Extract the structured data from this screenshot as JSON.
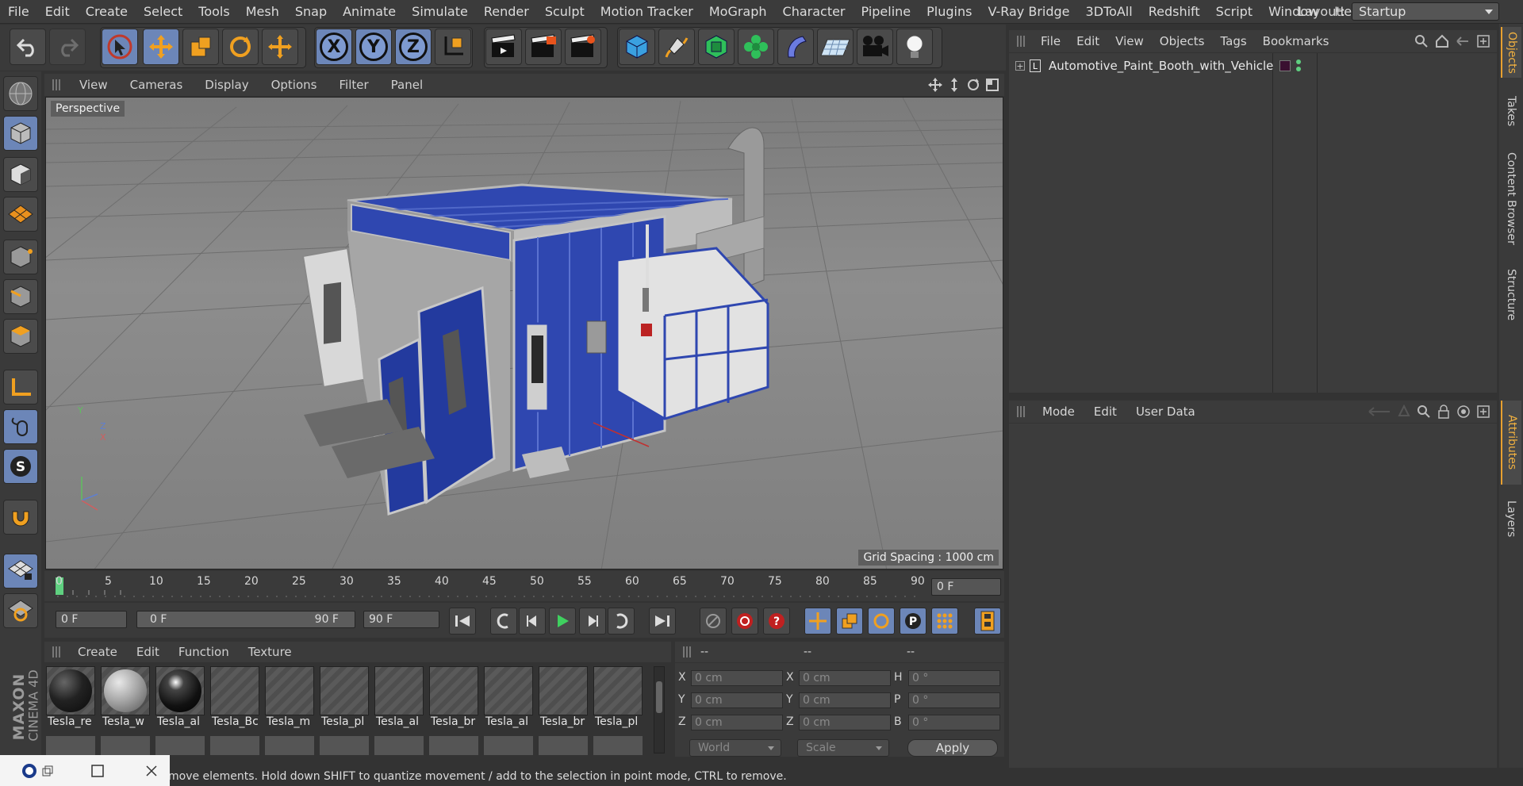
{
  "menubar": {
    "items": [
      "File",
      "Edit",
      "Create",
      "Select",
      "Tools",
      "Mesh",
      "Snap",
      "Animate",
      "Simulate",
      "Render",
      "Sculpt",
      "Motion Tracker",
      "MoGraph",
      "Character",
      "Pipeline",
      "Plugins",
      "V-Ray Bridge",
      "3DToAll",
      "Redshift",
      "Script",
      "Window",
      "Help"
    ],
    "layout_label": "Layout:",
    "layout_value": "Startup"
  },
  "toolbar": {
    "axis_x": "X",
    "axis_y": "Y",
    "axis_z": "Z"
  },
  "viewport": {
    "menu": [
      "View",
      "Cameras",
      "Display",
      "Options",
      "Filter",
      "Panel"
    ],
    "label": "Perspective",
    "grid_spacing": "Grid Spacing : 1000 cm",
    "axis_y": "Y",
    "axis_z": "Z",
    "axis_x": "X"
  },
  "timeline": {
    "ticks": [
      "0",
      "5",
      "10",
      "15",
      "20",
      "25",
      "30",
      "35",
      "40",
      "45",
      "50",
      "55",
      "60",
      "65",
      "70",
      "75",
      "80",
      "85",
      "90"
    ],
    "current_frame": "0 F"
  },
  "transport": {
    "start": "0 F",
    "range_start": "0 F",
    "range_end": "90 F",
    "end": "90 F"
  },
  "materials": {
    "menu": [
      "Create",
      "Edit",
      "Function",
      "Texture"
    ],
    "items": [
      "Tesla_re",
      "Tesla_w",
      "Tesla_al",
      "Tesla_Bc",
      "Tesla_m",
      "Tesla_pl",
      "Tesla_al",
      "Tesla_br",
      "Tesla_al",
      "Tesla_br",
      "Tesla_pl"
    ]
  },
  "coords": {
    "head": [
      "--",
      "--",
      "--"
    ],
    "rows": [
      {
        "l1": "X",
        "v1": "0 cm",
        "l2": "X",
        "v2": "0 cm",
        "l3": "H",
        "v3": "0 °"
      },
      {
        "l1": "Y",
        "v1": "0 cm",
        "l2": "Y",
        "v2": "0 cm",
        "l3": "P",
        "v3": "0 °"
      },
      {
        "l1": "Z",
        "v1": "0 cm",
        "l2": "Z",
        "v2": "0 cm",
        "l3": "B",
        "v3": "0 °"
      }
    ],
    "world": "World",
    "scale": "Scale",
    "apply": "Apply"
  },
  "objects": {
    "menu": [
      "File",
      "Edit",
      "View",
      "Objects",
      "Tags",
      "Bookmarks"
    ],
    "root_name": "Automotive_Paint_Booth_with_Vehicle"
  },
  "attributes": {
    "menu": [
      "Mode",
      "Edit",
      "User Data"
    ]
  },
  "righttabs": [
    "Objects",
    "Takes",
    "Content Browser",
    "Structure",
    "Attributes",
    "Layers"
  ],
  "status": {
    "text": "move elements. Hold down SHIFT to quantize movement / add to the selection in point mode, CTRL to remove."
  },
  "brand": {
    "line1": "MAXON",
    "line2": "CINEMA 4D"
  },
  "colors": {
    "accent": "#6c86b8",
    "booth_blue": "#2f47b0",
    "tab_highlight": "#e8a030"
  }
}
